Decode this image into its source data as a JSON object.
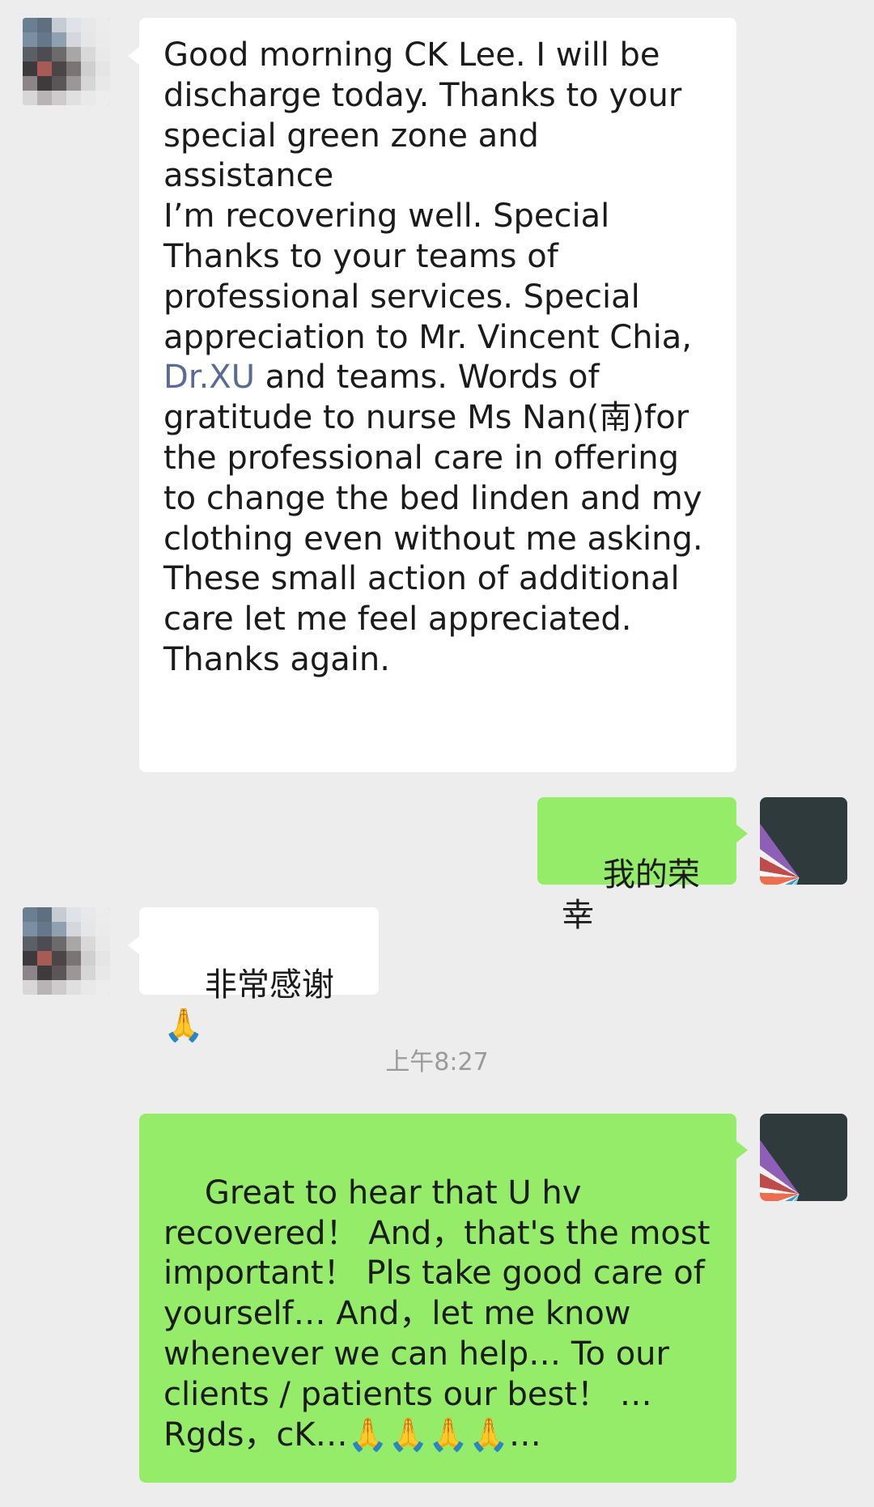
{
  "messages": [
    {
      "sender": "contact",
      "segments": [
        "Good morning CK Lee. I will be\ndischarge today. Thanks to your\nspecial green zone and assistance\nI’m recovering well. Special\nThanks to your teams of\nprofessional services. Special\nappreciation to Mr. Vincent Chia,\n",
        "Dr.XU",
        " and teams. Words of\ngratitude to nurse Ms Nan(南)for\nthe professional care in offering\nto change the bed linden and my\nclothing even without me asking.\nThese small action of additional\ncare let me feel appreciated.\nThanks again."
      ]
    },
    {
      "sender": "me",
      "text": "我的荣幸"
    },
    {
      "sender": "contact",
      "text": "非常感谢🙏"
    },
    {
      "type": "timestamp",
      "text": "上午8:27"
    },
    {
      "sender": "me",
      "text": "Great to hear that U hv\nrecovered！ And，that's the most\nimportant！ Pls take good care of\nyourself… And，let me know\nwhenever we can help… To our\nclients / patients our best！ …\nRgds，cK…🙏🙏🙏🙏…"
    }
  ],
  "colors": {
    "background": "#ededed",
    "incoming_bubble": "#ffffff",
    "outgoing_bubble": "#95ec69",
    "link": "#576b95",
    "timestamp": "#9a9a9a"
  },
  "icons": {
    "contact_avatar": "blurred-contact-avatar",
    "self_avatar": "color-fan-avatar"
  }
}
